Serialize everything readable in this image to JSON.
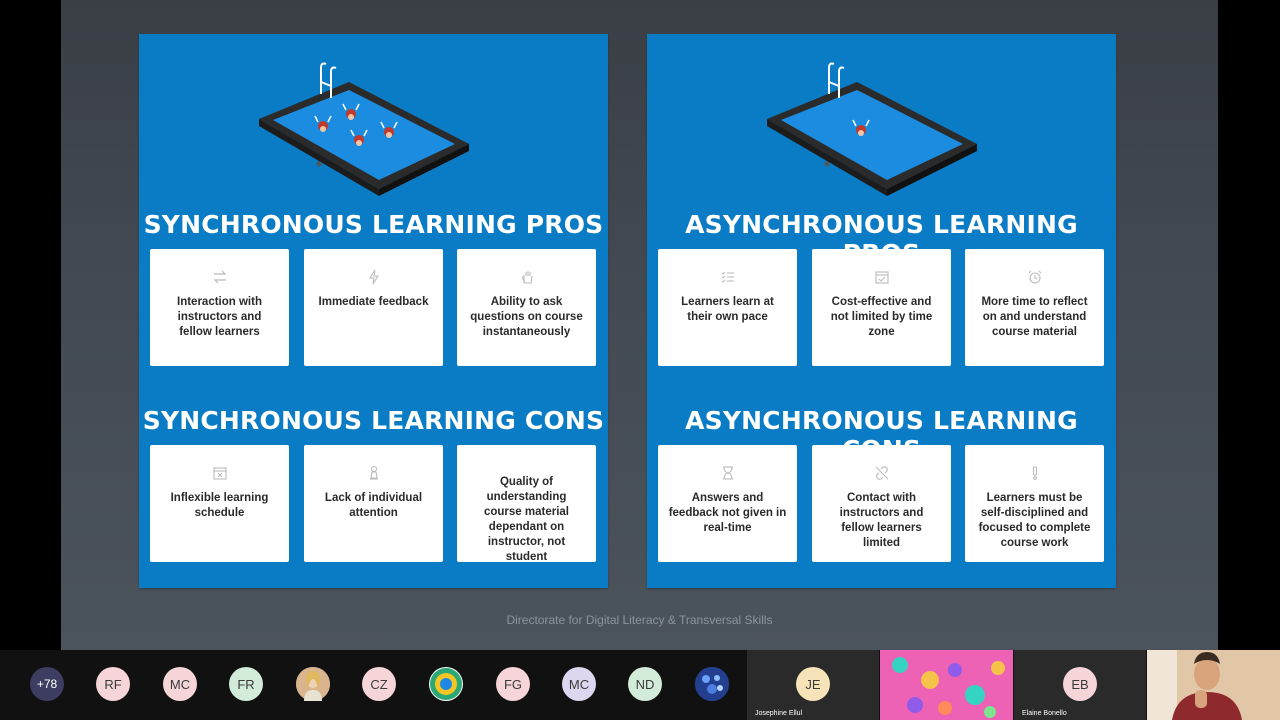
{
  "slides": {
    "synchronous": {
      "pros_title": "SYNCHRONOUS LEARNING PROS",
      "cons_title": "SYNCHRONOUS LEARNING CONS",
      "pros": [
        {
          "text": "Interaction with instructors and fellow learners",
          "icon": "arrows-swap-icon"
        },
        {
          "text": "Immediate feedback",
          "icon": "lightning-icon"
        },
        {
          "text": "Ability to ask questions on course instantaneously",
          "icon": "raised-hand-icon"
        }
      ],
      "cons": [
        {
          "text": "Inflexible learning schedule",
          "icon": "calendar-x-icon"
        },
        {
          "text": "Lack of individual attention",
          "icon": "pawn-icon"
        },
        {
          "text": "Quality of understanding course material dependant on instructor, not student",
          "icon": "podium-icon"
        }
      ]
    },
    "asynchronous": {
      "pros_title": "ASYNCHRONOUS LEARNING PROS",
      "cons_title": "ASYNCHRONOUS LEARNING CONS",
      "pros": [
        {
          "text": "Learners learn at their own pace",
          "icon": "checklist-icon"
        },
        {
          "text": "Cost-effective and not limited by time zone",
          "icon": "calendar-check-icon"
        },
        {
          "text": "More time to reflect on and understand course material",
          "icon": "alarm-clock-icon"
        }
      ],
      "cons": [
        {
          "text": "Answers and feedback not given in real-time",
          "icon": "hourglass-icon"
        },
        {
          "text": "Contact with instructors and fellow learners limited",
          "icon": "broken-link-icon"
        },
        {
          "text": "Learners must be self-disciplined and focused to complete course work",
          "icon": "exclamation-icon"
        }
      ]
    }
  },
  "footer": "Directorate for Digital Literacy & Transversal Skills",
  "participants": {
    "more_count": "+78",
    "initials": [
      "RF",
      "MC",
      "FR",
      "CZ",
      "FG",
      "MC",
      "ND"
    ],
    "tiles": [
      {
        "initials": "JE",
        "name": "Josephine Ellul"
      },
      {
        "initials": "EB",
        "name": "Elaine Bonello"
      }
    ]
  },
  "colors": {
    "panel_blue": "#0a7bc5",
    "card_white": "#ffffff",
    "stage_gray": "#434a53"
  }
}
